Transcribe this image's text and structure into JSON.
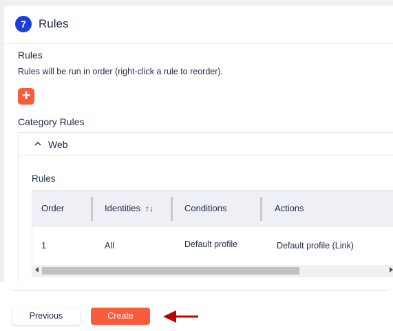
{
  "step": {
    "number": "7",
    "title": "Rules"
  },
  "rules_section": {
    "label": "Rules",
    "description": "Rules will be run in order (right-click a rule to reorder).",
    "add_icon": "plus-icon"
  },
  "category_rules": {
    "label": "Category Rules",
    "category": {
      "name": "Web",
      "expanded": true,
      "rules_label": "Rules",
      "columns": [
        "Order",
        "Identities",
        "Conditions",
        "Actions"
      ],
      "sort_icon": "↑↓",
      "rows": [
        {
          "order": "1",
          "identities": "All",
          "conditions": "Default profile",
          "actions": "Default profile (Link)"
        }
      ],
      "horizontal_scroll": 0.0
    }
  },
  "footer": {
    "previous_label": "Previous",
    "create_label": "Create"
  },
  "colors": {
    "accent": "#f95c3a",
    "step_badge": "#1a3fd6",
    "annotation_arrow": "#c00000"
  }
}
